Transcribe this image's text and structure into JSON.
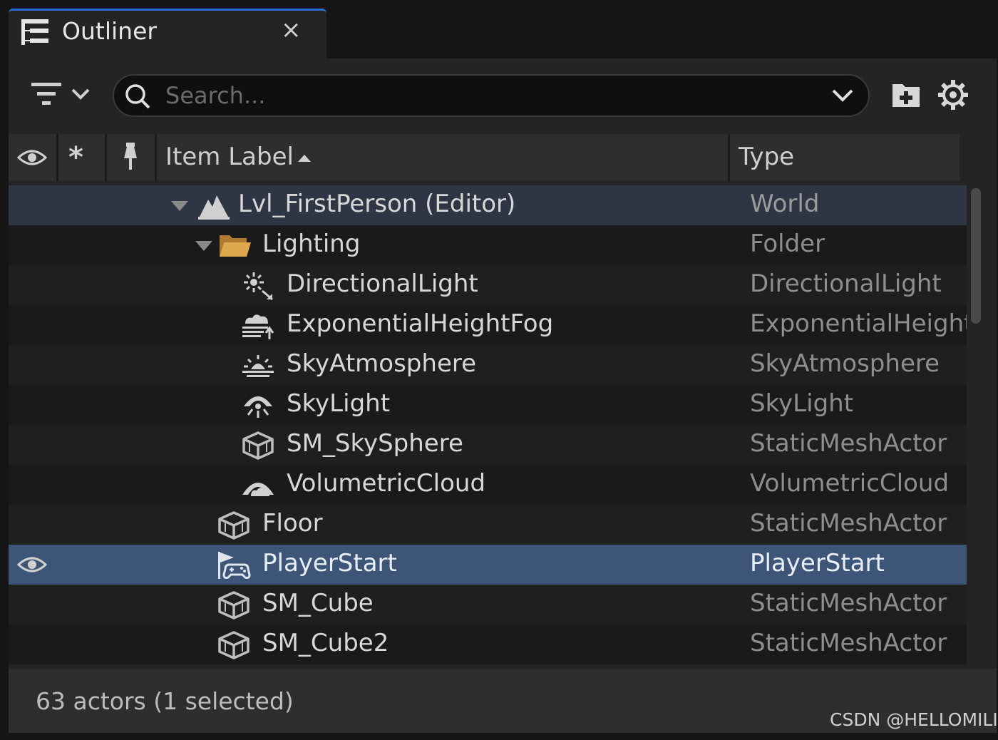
{
  "tab": {
    "title": "Outliner",
    "close_glyph": "×",
    "icon": "outliner-icon"
  },
  "toolbar": {
    "filter_icon": "filter-icon",
    "search_placeholder": "Search...",
    "search_value": "",
    "new_folder_icon": "new-folder-icon",
    "settings_icon": "gear-icon"
  },
  "columns": {
    "visibility_icon": "eye-icon",
    "unsaved_glyph": "*",
    "pin_icon": "pin-icon",
    "label": "Item Label",
    "type": "Type",
    "sort": "ascending"
  },
  "rows": [
    {
      "label": "Lvl_FirstPerson (Editor)",
      "type": "World",
      "icon": "world-icon",
      "expanded": true,
      "selected": false,
      "visible_eye": false
    },
    {
      "label": "Lighting",
      "type": "Folder",
      "icon": "folder-icon",
      "expanded": true,
      "selected": false,
      "visible_eye": false
    },
    {
      "label": "DirectionalLight",
      "type": "DirectionalLight",
      "icon": "directional-light-icon",
      "selected": false,
      "visible_eye": false
    },
    {
      "label": "ExponentialHeightFog",
      "type": "ExponentialHeightFog",
      "icon": "height-fog-icon",
      "selected": false,
      "visible_eye": false
    },
    {
      "label": "SkyAtmosphere",
      "type": "SkyAtmosphere",
      "icon": "sky-atmosphere-icon",
      "selected": false,
      "visible_eye": false
    },
    {
      "label": "SkyLight",
      "type": "SkyLight",
      "icon": "sky-light-icon",
      "selected": false,
      "visible_eye": false
    },
    {
      "label": "SM_SkySphere",
      "type": "StaticMeshActor",
      "icon": "static-mesh-icon",
      "selected": false,
      "visible_eye": false
    },
    {
      "label": "VolumetricCloud",
      "type": "VolumetricCloud",
      "icon": "volumetric-cloud-icon",
      "selected": false,
      "visible_eye": false
    },
    {
      "label": "Floor",
      "type": "StaticMeshActor",
      "icon": "static-mesh-icon",
      "selected": false,
      "visible_eye": false
    },
    {
      "label": "PlayerStart",
      "type": "PlayerStart",
      "icon": "player-start-icon",
      "selected": true,
      "visible_eye": true
    },
    {
      "label": "SM_Cube",
      "type": "StaticMeshActor",
      "icon": "static-mesh-icon",
      "selected": false,
      "visible_eye": false
    },
    {
      "label": "SM_Cube2",
      "type": "StaticMeshActor",
      "icon": "static-mesh-icon",
      "selected": false,
      "visible_eye": false
    }
  ],
  "footer": {
    "status": "63 actors (1 selected)"
  },
  "watermark": "CSDN @HELLOMILI",
  "colors": {
    "accent": "#2a6fd0",
    "selection": "#3d5677",
    "world_row": "#2e3645",
    "folder": "#d9a04a"
  }
}
